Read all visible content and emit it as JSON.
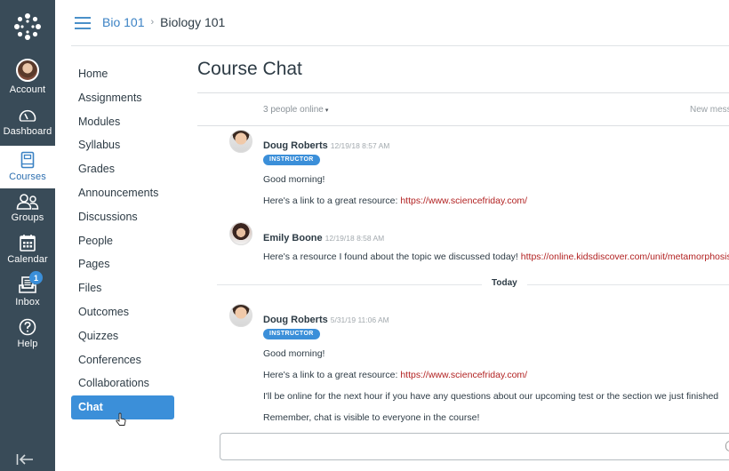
{
  "global_nav": {
    "items": [
      {
        "id": "account",
        "label": "Account",
        "icon": "avatar"
      },
      {
        "id": "dashboard",
        "label": "Dashboard",
        "icon": "speedometer-icon"
      },
      {
        "id": "courses",
        "label": "Courses",
        "icon": "book-icon",
        "active": true
      },
      {
        "id": "groups",
        "label": "Groups",
        "icon": "people-icon"
      },
      {
        "id": "calendar",
        "label": "Calendar",
        "icon": "calendar-icon"
      },
      {
        "id": "inbox",
        "label": "Inbox",
        "icon": "inbox-icon",
        "badge": "1"
      },
      {
        "id": "help",
        "label": "Help",
        "icon": "help-icon"
      }
    ],
    "collapse_icon": "collapse-arrow-icon"
  },
  "header": {
    "breadcrumb": [
      {
        "label": "Bio 101"
      },
      {
        "label": "Biology 101"
      }
    ],
    "separator": "›"
  },
  "course_nav": {
    "items": [
      "Home",
      "Assignments",
      "Modules",
      "Syllabus",
      "Grades",
      "Announcements",
      "Discussions",
      "People",
      "Pages",
      "Files",
      "Outcomes",
      "Quizzes",
      "Conferences",
      "Collaborations",
      "Chat"
    ],
    "active": "Chat"
  },
  "main": {
    "title": "Course Chat",
    "online_status": "3 people online",
    "online_caret": "▾",
    "new_messages": "New mess",
    "divider_label": "Today",
    "messages": [
      {
        "author": "Doug Roberts",
        "timestamp": "12/19/18 8:57 AM",
        "role": "INSTRUCTOR",
        "lines": [
          {
            "text": "Good morning!"
          },
          {
            "text": "Here's a link to a great resource: ",
            "link": "https://www.sciencefriday.com/"
          }
        ]
      },
      {
        "author": "Emily Boone",
        "timestamp": "12/19/18 8:58 AM",
        "lines": [
          {
            "text": "Here's a resource I found about the topic we discussed today! ",
            "link": "https://online.kidsdiscover.com/unit/metamorphosis"
          }
        ]
      },
      {
        "author": "Doug Roberts",
        "timestamp": "5/31/19 11:06 AM",
        "role": "INSTRUCTOR",
        "lines": [
          {
            "text": "Good morning!"
          },
          {
            "text": "Here's a link to a great resource: ",
            "link": "https://www.sciencefriday.com/"
          },
          {
            "text": "I'll be online for the next hour if you have any questions about our upcoming test or the section we just finished"
          },
          {
            "text": "Remember, chat is visible to everyone in the course!"
          }
        ]
      }
    ],
    "compose_value": ""
  },
  "colors": {
    "nav_bg": "#394b58",
    "accent": "#3b8fd9",
    "link": "#b22222"
  }
}
